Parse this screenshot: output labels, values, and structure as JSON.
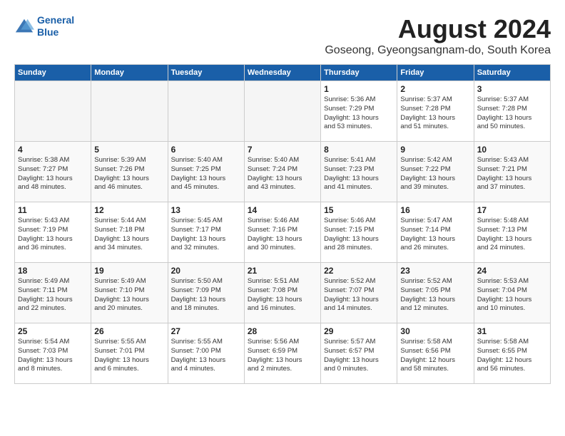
{
  "logo": {
    "line1": "General",
    "line2": "Blue"
  },
  "title": "August 2024",
  "location": "Goseong, Gyeongsangnam-do, South Korea",
  "weekdays": [
    "Sunday",
    "Monday",
    "Tuesday",
    "Wednesday",
    "Thursday",
    "Friday",
    "Saturday"
  ],
  "weeks": [
    [
      {
        "day": "",
        "content": ""
      },
      {
        "day": "",
        "content": ""
      },
      {
        "day": "",
        "content": ""
      },
      {
        "day": "",
        "content": ""
      },
      {
        "day": "1",
        "content": "Sunrise: 5:36 AM\nSunset: 7:29 PM\nDaylight: 13 hours\nand 53 minutes."
      },
      {
        "day": "2",
        "content": "Sunrise: 5:37 AM\nSunset: 7:28 PM\nDaylight: 13 hours\nand 51 minutes."
      },
      {
        "day": "3",
        "content": "Sunrise: 5:37 AM\nSunset: 7:28 PM\nDaylight: 13 hours\nand 50 minutes."
      }
    ],
    [
      {
        "day": "4",
        "content": "Sunrise: 5:38 AM\nSunset: 7:27 PM\nDaylight: 13 hours\nand 48 minutes."
      },
      {
        "day": "5",
        "content": "Sunrise: 5:39 AM\nSunset: 7:26 PM\nDaylight: 13 hours\nand 46 minutes."
      },
      {
        "day": "6",
        "content": "Sunrise: 5:40 AM\nSunset: 7:25 PM\nDaylight: 13 hours\nand 45 minutes."
      },
      {
        "day": "7",
        "content": "Sunrise: 5:40 AM\nSunset: 7:24 PM\nDaylight: 13 hours\nand 43 minutes."
      },
      {
        "day": "8",
        "content": "Sunrise: 5:41 AM\nSunset: 7:23 PM\nDaylight: 13 hours\nand 41 minutes."
      },
      {
        "day": "9",
        "content": "Sunrise: 5:42 AM\nSunset: 7:22 PM\nDaylight: 13 hours\nand 39 minutes."
      },
      {
        "day": "10",
        "content": "Sunrise: 5:43 AM\nSunset: 7:21 PM\nDaylight: 13 hours\nand 37 minutes."
      }
    ],
    [
      {
        "day": "11",
        "content": "Sunrise: 5:43 AM\nSunset: 7:19 PM\nDaylight: 13 hours\nand 36 minutes."
      },
      {
        "day": "12",
        "content": "Sunrise: 5:44 AM\nSunset: 7:18 PM\nDaylight: 13 hours\nand 34 minutes."
      },
      {
        "day": "13",
        "content": "Sunrise: 5:45 AM\nSunset: 7:17 PM\nDaylight: 13 hours\nand 32 minutes."
      },
      {
        "day": "14",
        "content": "Sunrise: 5:46 AM\nSunset: 7:16 PM\nDaylight: 13 hours\nand 30 minutes."
      },
      {
        "day": "15",
        "content": "Sunrise: 5:46 AM\nSunset: 7:15 PM\nDaylight: 13 hours\nand 28 minutes."
      },
      {
        "day": "16",
        "content": "Sunrise: 5:47 AM\nSunset: 7:14 PM\nDaylight: 13 hours\nand 26 minutes."
      },
      {
        "day": "17",
        "content": "Sunrise: 5:48 AM\nSunset: 7:13 PM\nDaylight: 13 hours\nand 24 minutes."
      }
    ],
    [
      {
        "day": "18",
        "content": "Sunrise: 5:49 AM\nSunset: 7:11 PM\nDaylight: 13 hours\nand 22 minutes."
      },
      {
        "day": "19",
        "content": "Sunrise: 5:49 AM\nSunset: 7:10 PM\nDaylight: 13 hours\nand 20 minutes."
      },
      {
        "day": "20",
        "content": "Sunrise: 5:50 AM\nSunset: 7:09 PM\nDaylight: 13 hours\nand 18 minutes."
      },
      {
        "day": "21",
        "content": "Sunrise: 5:51 AM\nSunset: 7:08 PM\nDaylight: 13 hours\nand 16 minutes."
      },
      {
        "day": "22",
        "content": "Sunrise: 5:52 AM\nSunset: 7:07 PM\nDaylight: 13 hours\nand 14 minutes."
      },
      {
        "day": "23",
        "content": "Sunrise: 5:52 AM\nSunset: 7:05 PM\nDaylight: 13 hours\nand 12 minutes."
      },
      {
        "day": "24",
        "content": "Sunrise: 5:53 AM\nSunset: 7:04 PM\nDaylight: 13 hours\nand 10 minutes."
      }
    ],
    [
      {
        "day": "25",
        "content": "Sunrise: 5:54 AM\nSunset: 7:03 PM\nDaylight: 13 hours\nand 8 minutes."
      },
      {
        "day": "26",
        "content": "Sunrise: 5:55 AM\nSunset: 7:01 PM\nDaylight: 13 hours\nand 6 minutes."
      },
      {
        "day": "27",
        "content": "Sunrise: 5:55 AM\nSunset: 7:00 PM\nDaylight: 13 hours\nand 4 minutes."
      },
      {
        "day": "28",
        "content": "Sunrise: 5:56 AM\nSunset: 6:59 PM\nDaylight: 13 hours\nand 2 minutes."
      },
      {
        "day": "29",
        "content": "Sunrise: 5:57 AM\nSunset: 6:57 PM\nDaylight: 13 hours\nand 0 minutes."
      },
      {
        "day": "30",
        "content": "Sunrise: 5:58 AM\nSunset: 6:56 PM\nDaylight: 12 hours\nand 58 minutes."
      },
      {
        "day": "31",
        "content": "Sunrise: 5:58 AM\nSunset: 6:55 PM\nDaylight: 12 hours\nand 56 minutes."
      }
    ]
  ]
}
